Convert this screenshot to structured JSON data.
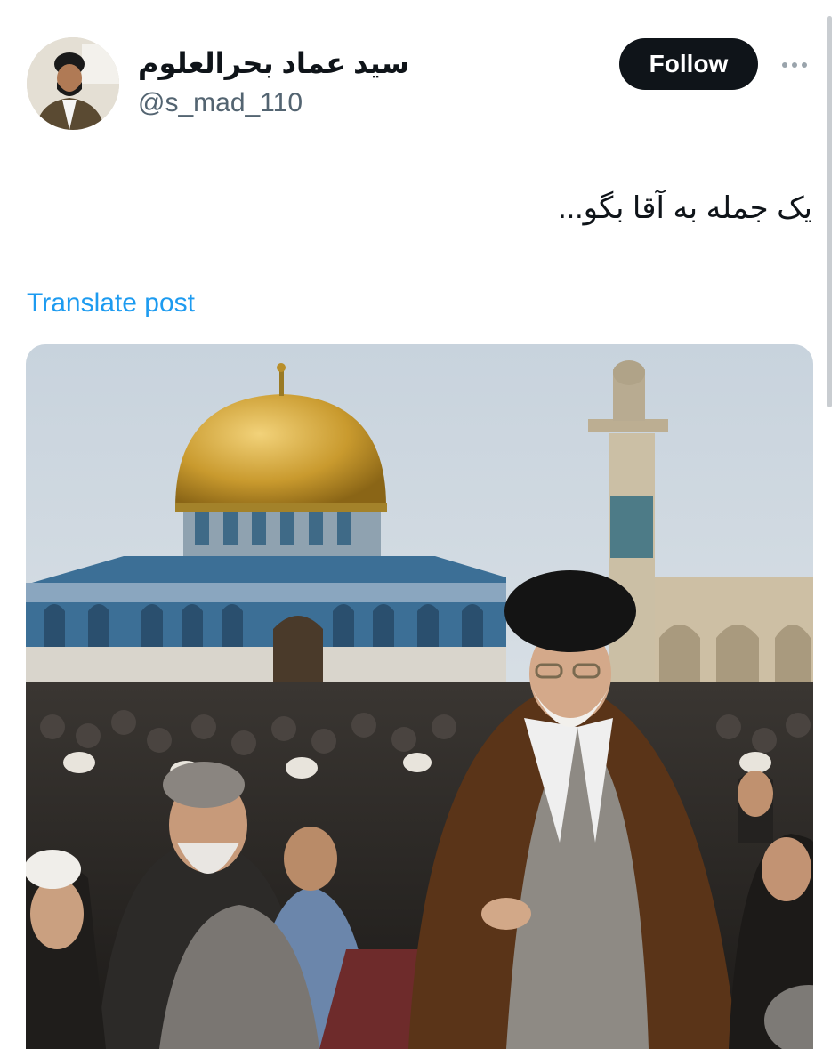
{
  "author": {
    "display_name": "سید عماد بحرالعلوم",
    "handle": "@s_mad_110",
    "avatar_icon": "profile-avatar"
  },
  "actions": {
    "follow_label": "Follow",
    "more_icon": "more-options-icon"
  },
  "post": {
    "text": "یک جمله به آقا بگو...",
    "translate_label": "Translate post"
  },
  "media": {
    "type": "image",
    "description_icon": "post-image"
  },
  "colors": {
    "link": "#1d9bf0",
    "follow_bg": "#0f1419",
    "handle": "#536471"
  }
}
